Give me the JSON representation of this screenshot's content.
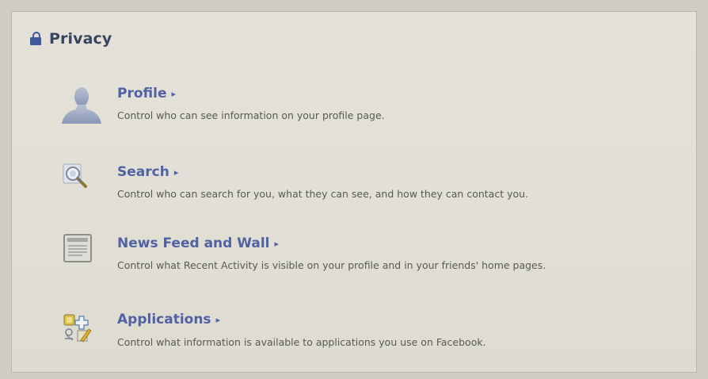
{
  "section": {
    "title": "Privacy",
    "icon": "lock-icon"
  },
  "items": [
    {
      "label": "Profile",
      "arrow": "▸",
      "description": "Control who can see information on your profile page.",
      "icon": "profile-silhouette-icon"
    },
    {
      "label": "Search",
      "arrow": "▸",
      "description": "Control who can search for you, what they can see, and how they can contact you.",
      "icon": "magnifier-icon"
    },
    {
      "label": "News Feed and Wall",
      "arrow": "▸",
      "description": "Control what Recent Activity is visible on your profile and in your friends' home pages.",
      "icon": "news-feed-icon"
    },
    {
      "label": "Applications",
      "arrow": "▸",
      "description": "Control what information is available to applications you use on Facebook.",
      "icon": "applications-icon"
    }
  ],
  "colors": {
    "link": "#5061a4",
    "title": "#39455f",
    "description": "#565a57",
    "background": "#e2dfd5"
  }
}
